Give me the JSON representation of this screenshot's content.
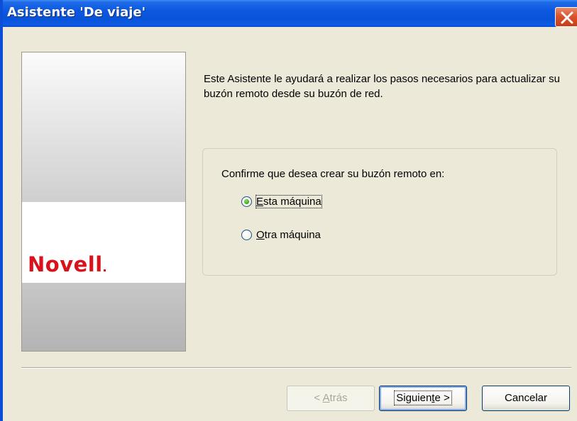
{
  "window": {
    "title": "Asistente 'De viaje'"
  },
  "banner": {
    "logo_text": "Novell"
  },
  "content": {
    "intro": "Este Asistente le ayudará a realizar los pasos necesarios para actualizar su buzón remoto desde su buzón de red.",
    "group_prompt": "Confirme que desea crear su buzón remoto en:",
    "options": [
      {
        "pre": "",
        "mnemonic": "E",
        "post": "sta máquina",
        "selected": true
      },
      {
        "pre": "",
        "mnemonic": "O",
        "post": "tra máquina",
        "selected": false
      }
    ]
  },
  "buttons": {
    "back": {
      "pre": "< ",
      "mnemonic": "A",
      "post": "trás",
      "enabled": false
    },
    "next": {
      "pre": "Siguien",
      "mnemonic": "t",
      "post": "e >",
      "default": true
    },
    "cancel": {
      "label": "Cancelar"
    }
  },
  "colors": {
    "titlebar": "#0a53d8",
    "dialog_bg": "#ece9d8",
    "logo": "#d9131c",
    "close_button": "#d8542f"
  }
}
